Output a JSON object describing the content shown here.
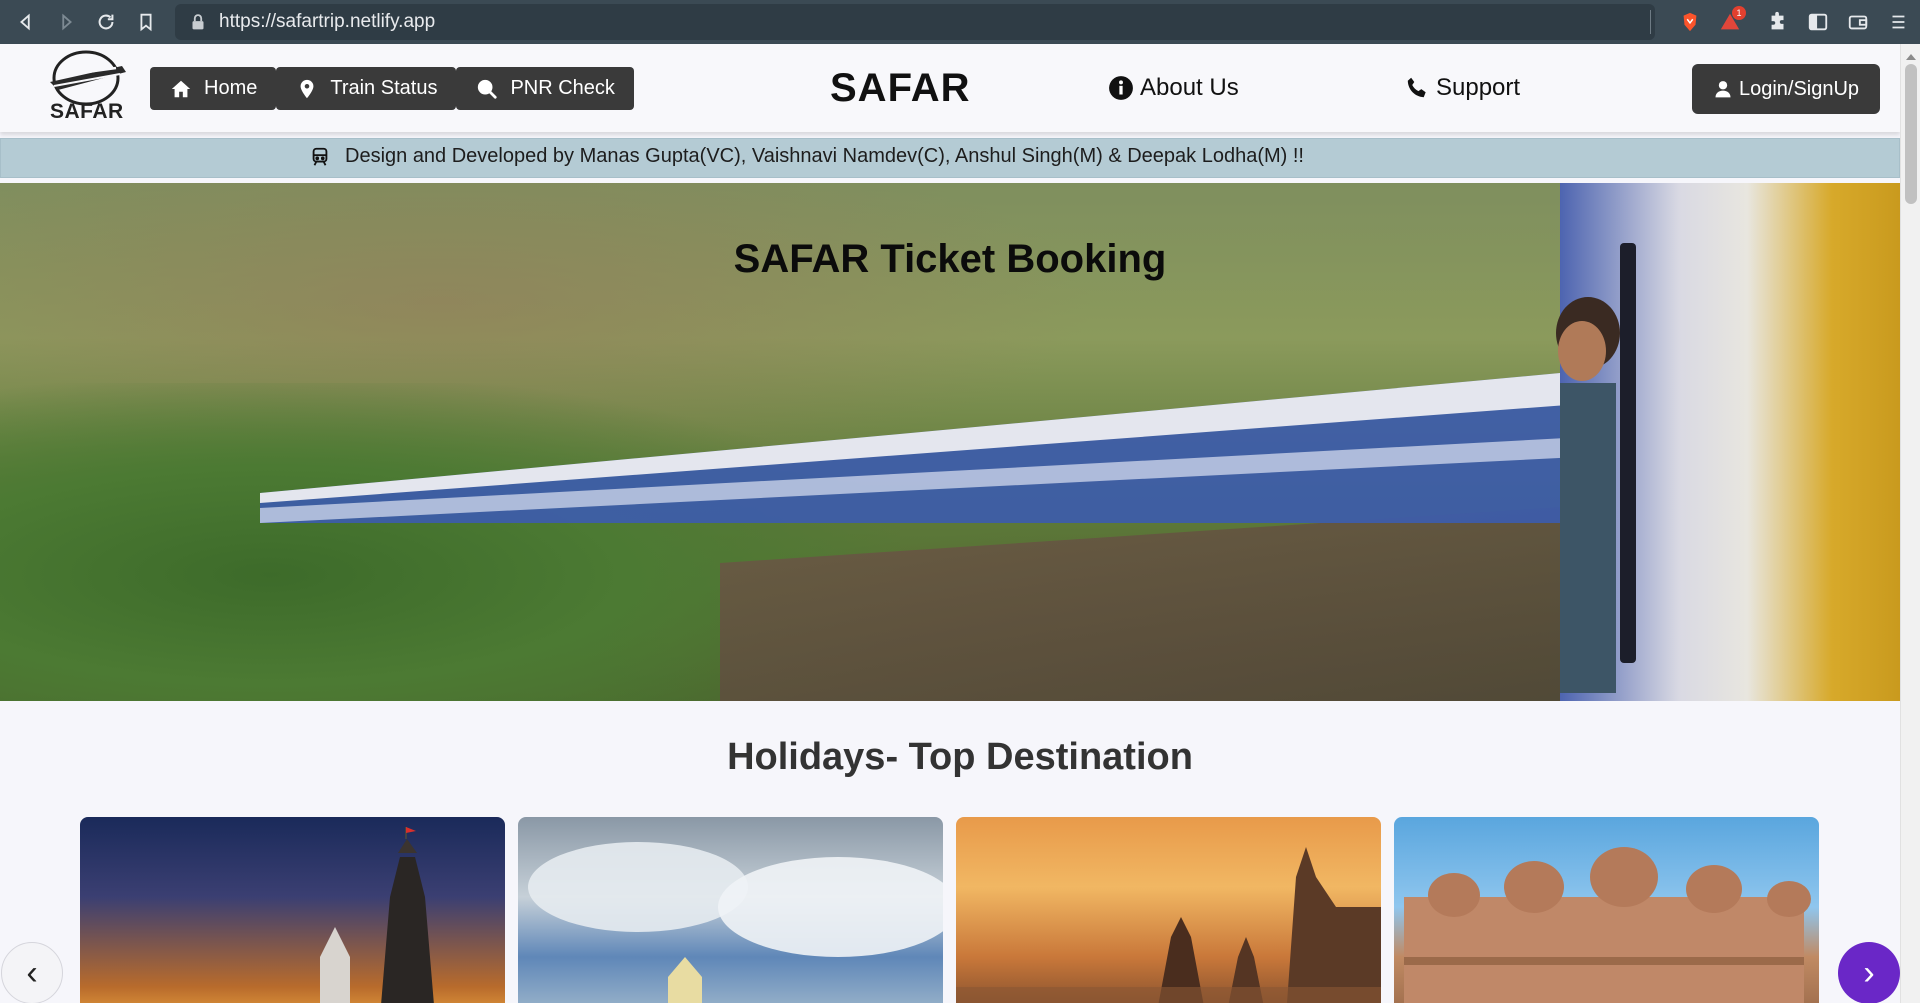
{
  "browser": {
    "url": "https://safartrip.netlify.app",
    "notification_count": "1"
  },
  "header": {
    "logo_text": "SAFAR",
    "nav": [
      {
        "label": "Home",
        "icon": "home-icon"
      },
      {
        "label": "Train Status",
        "icon": "map-pin-icon"
      },
      {
        "label": "PNR Check",
        "icon": "search-icon"
      }
    ],
    "brand": "SAFAR",
    "about_label": "About Us",
    "support_label": "Support",
    "login_label": "Login/SignUp"
  },
  "marquee": {
    "text": "Design and Developed by Manas Gupta(VC), Vaishnavi Namdev(C), Anshul Singh(M) & Deepak Lodha(M) !!"
  },
  "hero": {
    "title": "SAFAR Ticket Booking"
  },
  "destinations": {
    "title": "Holidays- Top Destination",
    "prev_label": "‹",
    "next_label": "›"
  },
  "colors": {
    "nav_bg": "#3a3a3a",
    "marquee_bg": "#b4cbd4",
    "accent_purple": "#6a27c7",
    "browser_bar": "#3b4a54"
  }
}
